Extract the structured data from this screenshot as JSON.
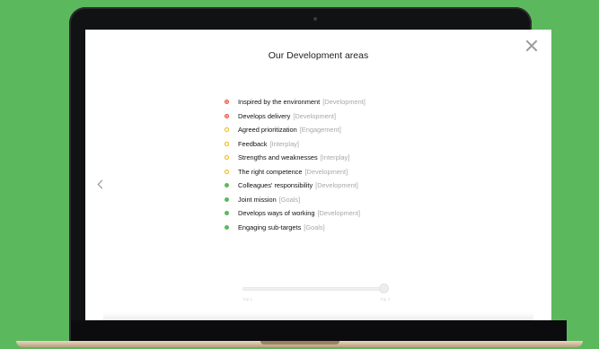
{
  "modal": {
    "title": "Our Development areas"
  },
  "areas": [
    {
      "name": "Inspired by the environment",
      "category": "[Development]",
      "status": "red"
    },
    {
      "name": "Develops delivery",
      "category": "[Development]",
      "status": "red"
    },
    {
      "name": "Agreed prioritization",
      "category": "[Engagement]",
      "status": "yellow"
    },
    {
      "name": "Feedback",
      "category": "[Interplay]",
      "status": "yellow"
    },
    {
      "name": "Strengths and weaknesses",
      "category": "[Interplay]",
      "status": "yellow"
    },
    {
      "name": "The right competence",
      "category": "[Development]",
      "status": "yellow"
    },
    {
      "name": "Colleagues' responsibility",
      "category": "[Development]",
      "status": "green"
    },
    {
      "name": "Joint mission",
      "category": "[Goals]",
      "status": "green"
    },
    {
      "name": "Develops ways of working",
      "category": "[Development]",
      "status": "green"
    },
    {
      "name": "Engaging sub-targets",
      "category": "[Goals]",
      "status": "green"
    }
  ],
  "slider": {
    "start_label": "Top 1",
    "end_label": "Top 4",
    "value_fraction": 1.0
  },
  "colors": {
    "background": "#5cb85c",
    "red": "#e74c3c",
    "yellow": "#f0b400",
    "green": "#5cb85c"
  },
  "icons": {
    "close": "close-icon",
    "prev": "chevron-left-icon"
  }
}
